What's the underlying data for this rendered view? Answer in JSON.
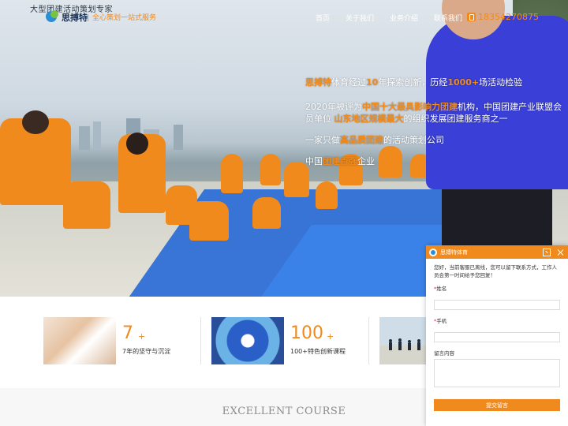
{
  "header": {
    "logo_subtitle": "大型团建活动策划专家",
    "logo_name": "思搏特",
    "logo_slogan": "全心策划一站式服务",
    "nav": [
      "首页",
      "关于我们",
      "业务介绍",
      "联系我们"
    ],
    "phone": "18354270875",
    "colors": {
      "accent": "#f08a1c",
      "nav_text": "#ffffff"
    }
  },
  "hero": {
    "line1": {
      "a": "思搏特",
      "b": "体育经过",
      "c": "10",
      "d": "年探索创新，历经",
      "e": "1000+",
      "f": "场活动检验"
    },
    "line2": {
      "a": "2020年被评为",
      "b": "中国十大最具影响力团建",
      "c": "机构，中国团建产业联盟会员单位 ",
      "d": "山东地区规模最大",
      "e": "的组织发展团建服务商之一"
    },
    "line3": {
      "a": "一家只做",
      "b": "高品质团建",
      "c": "的活动策划公司"
    },
    "line4": {
      "a": "中国",
      "b": "团建百强",
      "c": "企业"
    }
  },
  "features": [
    {
      "number": "7",
      "plus": "+",
      "label": "7年的坚守与沉淀",
      "image_icon": "team-photo"
    },
    {
      "number": "100",
      "plus": "+",
      "label": "100+特色创新课程",
      "image_icon": "circle-hands-photo"
    },
    {
      "number": "",
      "plus": "",
      "label": "",
      "image_icon": "runners-photo"
    }
  ],
  "course": {
    "title": "EXCELLENT COURSE"
  },
  "chat": {
    "title": "思搏特体育",
    "message": "您好，当前客服已离线，您可以留下联系方式，工作人员会第一时间给予您回复！",
    "name_label": "姓名",
    "phone_label": "手机",
    "message_label": "留言内容",
    "required_mark": "*",
    "submit_label": "提交留言"
  }
}
